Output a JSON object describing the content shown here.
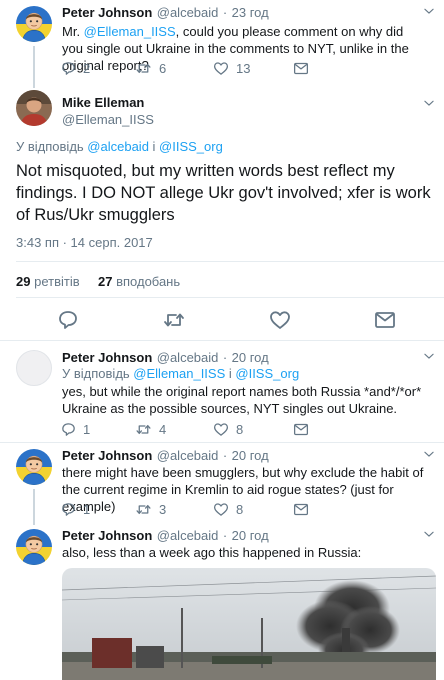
{
  "tweet1": {
    "name": "Peter Johnson",
    "handle": "@alcebaid",
    "sep": "·",
    "time": "23 год",
    "text_pre": "Mr. ",
    "mention": "@Elleman_IISS",
    "text_post": ", could you please comment on why did you single out Ukraine in the comments to NYT, unlike in the original report?",
    "replies": "2",
    "retweets": "6",
    "likes": "13"
  },
  "main": {
    "name": "Mike Elleman",
    "handle": "@Elleman_IISS",
    "reply_prefix": "У відповідь ",
    "reply_to1": "@alcebaid",
    "reply_and": " і ",
    "reply_to2": "@IISS_org",
    "text": "Not misquoted, but my written words best reflect my findings. I DO NOT allege Ukr gov't involved; xfer is work of Rus/Ukr smugglers",
    "timestamp": "3:43 пп · 14 серп. 2017",
    "retweets_count": "29",
    "retweets_label": "ретвітів",
    "likes_count": "27",
    "likes_label": "вподобань"
  },
  "reply1": {
    "name": "Peter Johnson",
    "handle": "@alcebaid",
    "sep": "·",
    "time": "20 год",
    "reply_prefix": "У відповідь ",
    "reply_to1": "@Elleman_IISS",
    "reply_and": " і ",
    "reply_to2": "@IISS_org",
    "text": "yes, but while the original report names both Russia *and*/*or* Ukraine as the possible sources, NYT singles out Ukraine.",
    "replies": "1",
    "retweets": "4",
    "likes": "8"
  },
  "reply2": {
    "name": "Peter Johnson",
    "handle": "@alcebaid",
    "sep": "·",
    "time": "20 год",
    "text": "there might have been smugglers, but why exclude the habit of the current regime in Kremlin to aid rogue states? (just for example)",
    "replies": "1",
    "retweets": "3",
    "likes": "8"
  },
  "reply3": {
    "name": "Peter Johnson",
    "handle": "@alcebaid",
    "sep": "·",
    "time": "20 год",
    "text": "also, less than a week ago this happened in Russia:"
  },
  "colors": {
    "link": "#1da1f2",
    "gray": "#657786",
    "border": "#e6ecf0",
    "ukraine_blue": "#2b72c8",
    "ukraine_yellow": "#f2d230"
  }
}
